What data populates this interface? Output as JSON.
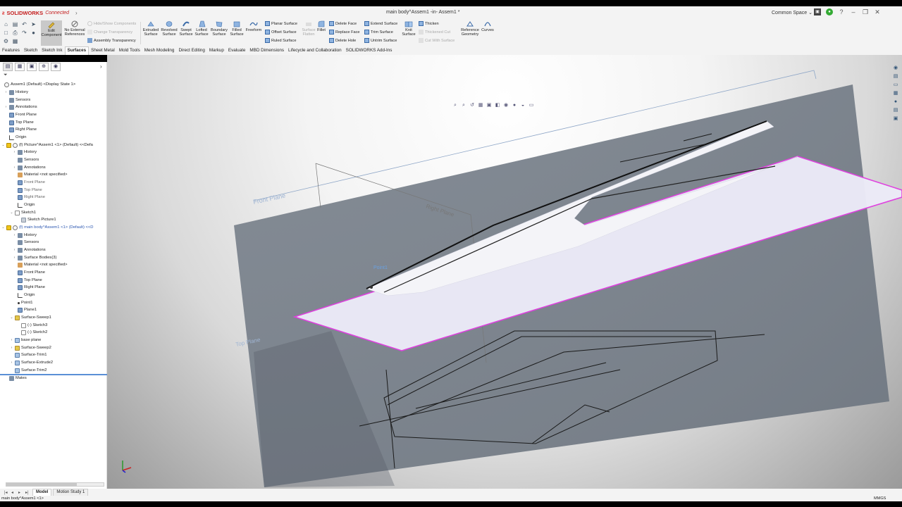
{
  "app": {
    "brand": "SOLIDWORKS",
    "connected": "Connected",
    "doc_title": "main body^Assem1 -in- Assem1 *",
    "common_space": "Common Space",
    "colors": {
      "brand_red": "#c41d1d",
      "accent_blue": "#5a8fd6",
      "selection_magenta": "#e040e0"
    }
  },
  "toolbar": {
    "edit_component": "Edit Component",
    "no_external": "No External References",
    "hide_show": "Hide/Show Components",
    "change_transparency": "Change Transparency",
    "assembly_transparency": "Assembly Transparency",
    "extruded_surface": "Extruded Surface",
    "revolved_surface": "Revolved Surface",
    "swept_surface": "Swept Surface",
    "lofted_surface": "Lofted Surface",
    "boundary_surface": "Boundary Surface",
    "filled_surface": "Filled Surface",
    "freeform": "Freeform",
    "planar_surface": "Planar Surface",
    "offset_surface": "Offset Surface",
    "ruled_surface": "Ruled Surface",
    "surface_flatten": "Surface Flatten",
    "fillet": "Fillet",
    "delete_face": "Delete Face",
    "replace_face": "Replace Face",
    "delete_hole": "Delete Hole",
    "extend_surface": "Extend Surface",
    "trim_surface": "Trim Surface",
    "untrim_surface": "Untrim Surface",
    "knit_surface": "Knit Surface",
    "thicken": "Thicken",
    "thickened_cut": "Thickened Cut",
    "cut_with_surface": "Cut With Surface",
    "reference_geometry": "Reference Geometry",
    "curves": "Curves"
  },
  "tabs": [
    "Features",
    "Sketch",
    "Sketch Ink",
    "Surfaces",
    "Sheet Metal",
    "Mold Tools",
    "Mesh Modeling",
    "Direct Editing",
    "Markup",
    "Evaluate",
    "MBD Dimensions",
    "Lifecycle and Collaboration",
    "SOLIDWORKS Add-Ins"
  ],
  "active_tab": "Surfaces",
  "tree": {
    "root": "Assem1 (Default) <Display State 1>",
    "history": "History",
    "sensors": "Sensors",
    "annotations": "Annotations",
    "front_plane": "Front Plane",
    "top_plane": "Top Plane",
    "right_plane": "Right Plane",
    "origin": "Origin",
    "picture_part": "(f) Picture^Assem1 <1> (Default) <<Defa",
    "material": "Material <not specified>",
    "sketch1": "Sketch1",
    "sketch_picture1": "Sketch Picture1",
    "main_body": "(f) main body^Assem1 <1> (Default) <<D",
    "surface_bodies": "Surface Bodies(3)",
    "point1": "Point1",
    "plane1": "Plane1",
    "surface_sweep1": "Surface-Sweep1",
    "sketch3": "(-) Sketch3",
    "sketch2": "(-) Sketch2",
    "base_plane": "base plane",
    "surface_sweep2": "Surface-Sweep2",
    "surface_trim1": "Surface-Trim1",
    "surface_extrude2": "Surface-Extrude2",
    "surface_trim2": "Surface-Trim2",
    "mates": "Mates"
  },
  "viewport": {
    "front_plane": "Front Plane",
    "right_plane": "Right Plane",
    "top_plane": "Top Plane",
    "point": "Point1"
  },
  "bottom": {
    "model": "Model",
    "motion_study": "Motion Study 1"
  },
  "status": {
    "left": "main body^Assem1 <1>",
    "units": "MMGS"
  }
}
